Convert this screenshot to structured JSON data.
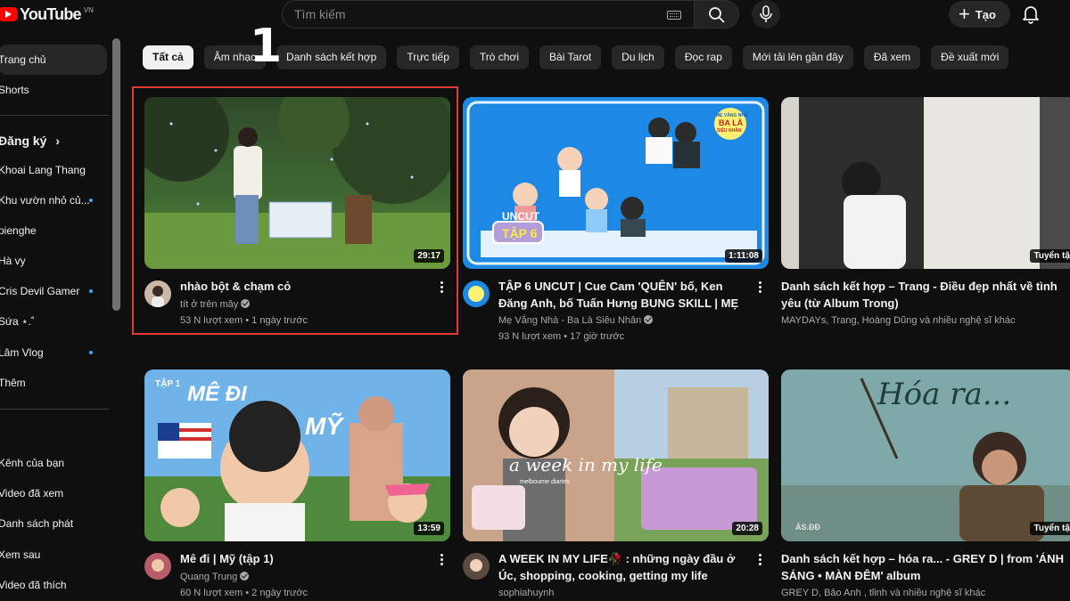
{
  "header": {
    "logo_text": "YouTube",
    "country_code": "VN",
    "search_placeholder": "Tìm kiếm",
    "create_label": "Tạo"
  },
  "sidebar": {
    "items": [
      {
        "label": "Trang chủ",
        "active": true
      },
      {
        "label": "Shorts"
      }
    ],
    "subscriptions_heading": "Đăng ký",
    "subscriptions": [
      {
        "label": "Khoai Lang Thang",
        "new": false
      },
      {
        "label": "Khu vườn nhỏ củ...",
        "new": true
      },
      {
        "label": "pienghe",
        "new": false
      },
      {
        "label": "Hà vy",
        "new": false
      },
      {
        "label": "Cris Devil Gamer",
        "new": true
      },
      {
        "label": "Sứa ⋆.˚",
        "new": false
      },
      {
        "label": "Lâm Vlog",
        "new": true
      },
      {
        "label": "Thêm",
        "new": false
      }
    ],
    "you_items": [
      {
        "label": "Kênh của bạn"
      },
      {
        "label": "Video đã xem"
      },
      {
        "label": "Danh sách phát"
      },
      {
        "label": "Xem sau"
      },
      {
        "label": "Video đã thích"
      }
    ]
  },
  "chips": [
    "Tất cả",
    "Âm nhạc",
    "Danh sách kết hợp",
    "Trực tiếp",
    "Trò chơi",
    "Bài Tarot",
    "Du lịch",
    "Đọc rap",
    "Mới tải lên gần đây",
    "Đã xem",
    "Đề xuất mới"
  ],
  "annotation_number": "1",
  "videos": [
    {
      "title": "nhào bột & chạm cỏ",
      "channel": "tít ở trên mây",
      "verified": true,
      "stats": "53 N lượt xem • 1 ngày trước",
      "duration": "29:17"
    },
    {
      "title": "TẬP 6 UNCUT | Cue Cam 'QUÊN' bố, Ken Đăng Anh, bố Tuấn Hưng BUNG SKILL | MẸ VẮNG ...",
      "channel": "Mẹ Vắng Nhà - Ba Là Siêu Nhân",
      "verified": true,
      "stats": "93 N lượt xem • 17 giờ trước",
      "duration": "1:11:08",
      "thumb_text": {
        "badge_top": "MẸ VẮNG NHÀ",
        "badge_main": "BA LÀ",
        "badge_sub": "SIÊU NHÂN",
        "uncut": "UNCUT",
        "ep": "TẬP 6"
      }
    },
    {
      "title": "Danh sách kết hợp – Trang - Điều đẹp nhất về tình yêu (từ Album Trong)",
      "channel": "MAYDAYs, Trang, Hoàng Dũng và nhiều nghệ sĩ khác",
      "stats": "",
      "badge": "Tuyển tập"
    },
    {
      "title": "Mê đi | Mỹ (tập 1)",
      "channel": "Quang Trung",
      "verified": true,
      "stats": "60 N lượt xem • 2 ngày trước",
      "duration": "13:59",
      "thumb_text": {
        "ep": "TẬP 1",
        "word1": "MÊ ĐI",
        "word2": "MỸ"
      }
    },
    {
      "title": "A WEEK IN MY LIFE🥀 : những ngày đầu ở Úc, shopping, cooking, getting my life together, ...",
      "channel": "sophiahuynh",
      "verified": false,
      "stats": "",
      "duration": "20:28",
      "thumb_text": {
        "script": "a week in my life",
        "sub": "melbourne diaries"
      }
    },
    {
      "title": "Danh sách kết hợp – hóa ra... - GREY D | from 'ÁNH SÁNG • MÀN ĐÊM' album",
      "channel": "GREY D, Bảo Anh , tlinh và nhiều nghệ sĩ khác",
      "stats": "",
      "badge": "Tuyển tập",
      "thumb_text": {
        "script": "Hóa ra...",
        "logo": "ÁS.ĐĐ"
      }
    }
  ]
}
